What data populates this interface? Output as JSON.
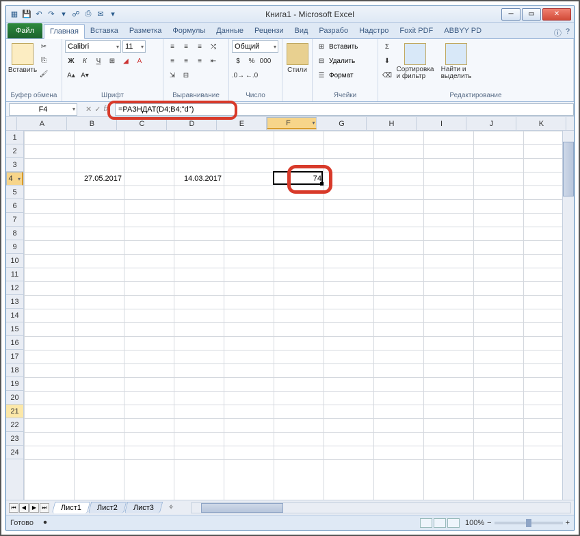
{
  "window": {
    "title": "Книга1 - Microsoft Excel"
  },
  "tabs": {
    "file": "Файл",
    "items": [
      "Главная",
      "Вставка",
      "Разметка",
      "Формулы",
      "Данные",
      "Рецензи",
      "Вид",
      "Разрабо",
      "Надстро",
      "Foxit PDF",
      "ABBYY PD"
    ],
    "active_index": 0
  },
  "ribbon": {
    "clipboard": {
      "label": "Вставить",
      "caption": "Буфер обмена"
    },
    "font": {
      "name": "Calibri",
      "size": "11",
      "caption": "Шрифт"
    },
    "alignment": {
      "caption": "Выравнивание"
    },
    "number": {
      "format": "Общий",
      "caption": "Число"
    },
    "styles": {
      "label": "Стили"
    },
    "cells": {
      "insert": "Вставить",
      "delete": "Удалить",
      "format": "Формат",
      "caption": "Ячейки"
    },
    "editing": {
      "sort": "Сортировка\nи фильтр",
      "find": "Найти и\nвыделить",
      "caption": "Редактирование"
    }
  },
  "namebox": "F4",
  "formula": "=РАЗНДАТ(D4;B4;\"d\")",
  "columns": [
    "A",
    "B",
    "C",
    "D",
    "E",
    "F",
    "G",
    "H",
    "I",
    "J",
    "K"
  ],
  "active_col_index": 5,
  "rows": 24,
  "active_row": 4,
  "highlight_row": 21,
  "cells": {
    "B4": "27.05.2017",
    "D4": "14.03.2017",
    "F4": "74"
  },
  "sheets": {
    "items": [
      "Лист1",
      "Лист2",
      "Лист3"
    ],
    "active_index": 0
  },
  "status": {
    "ready": "Готово",
    "zoom": "100%"
  }
}
